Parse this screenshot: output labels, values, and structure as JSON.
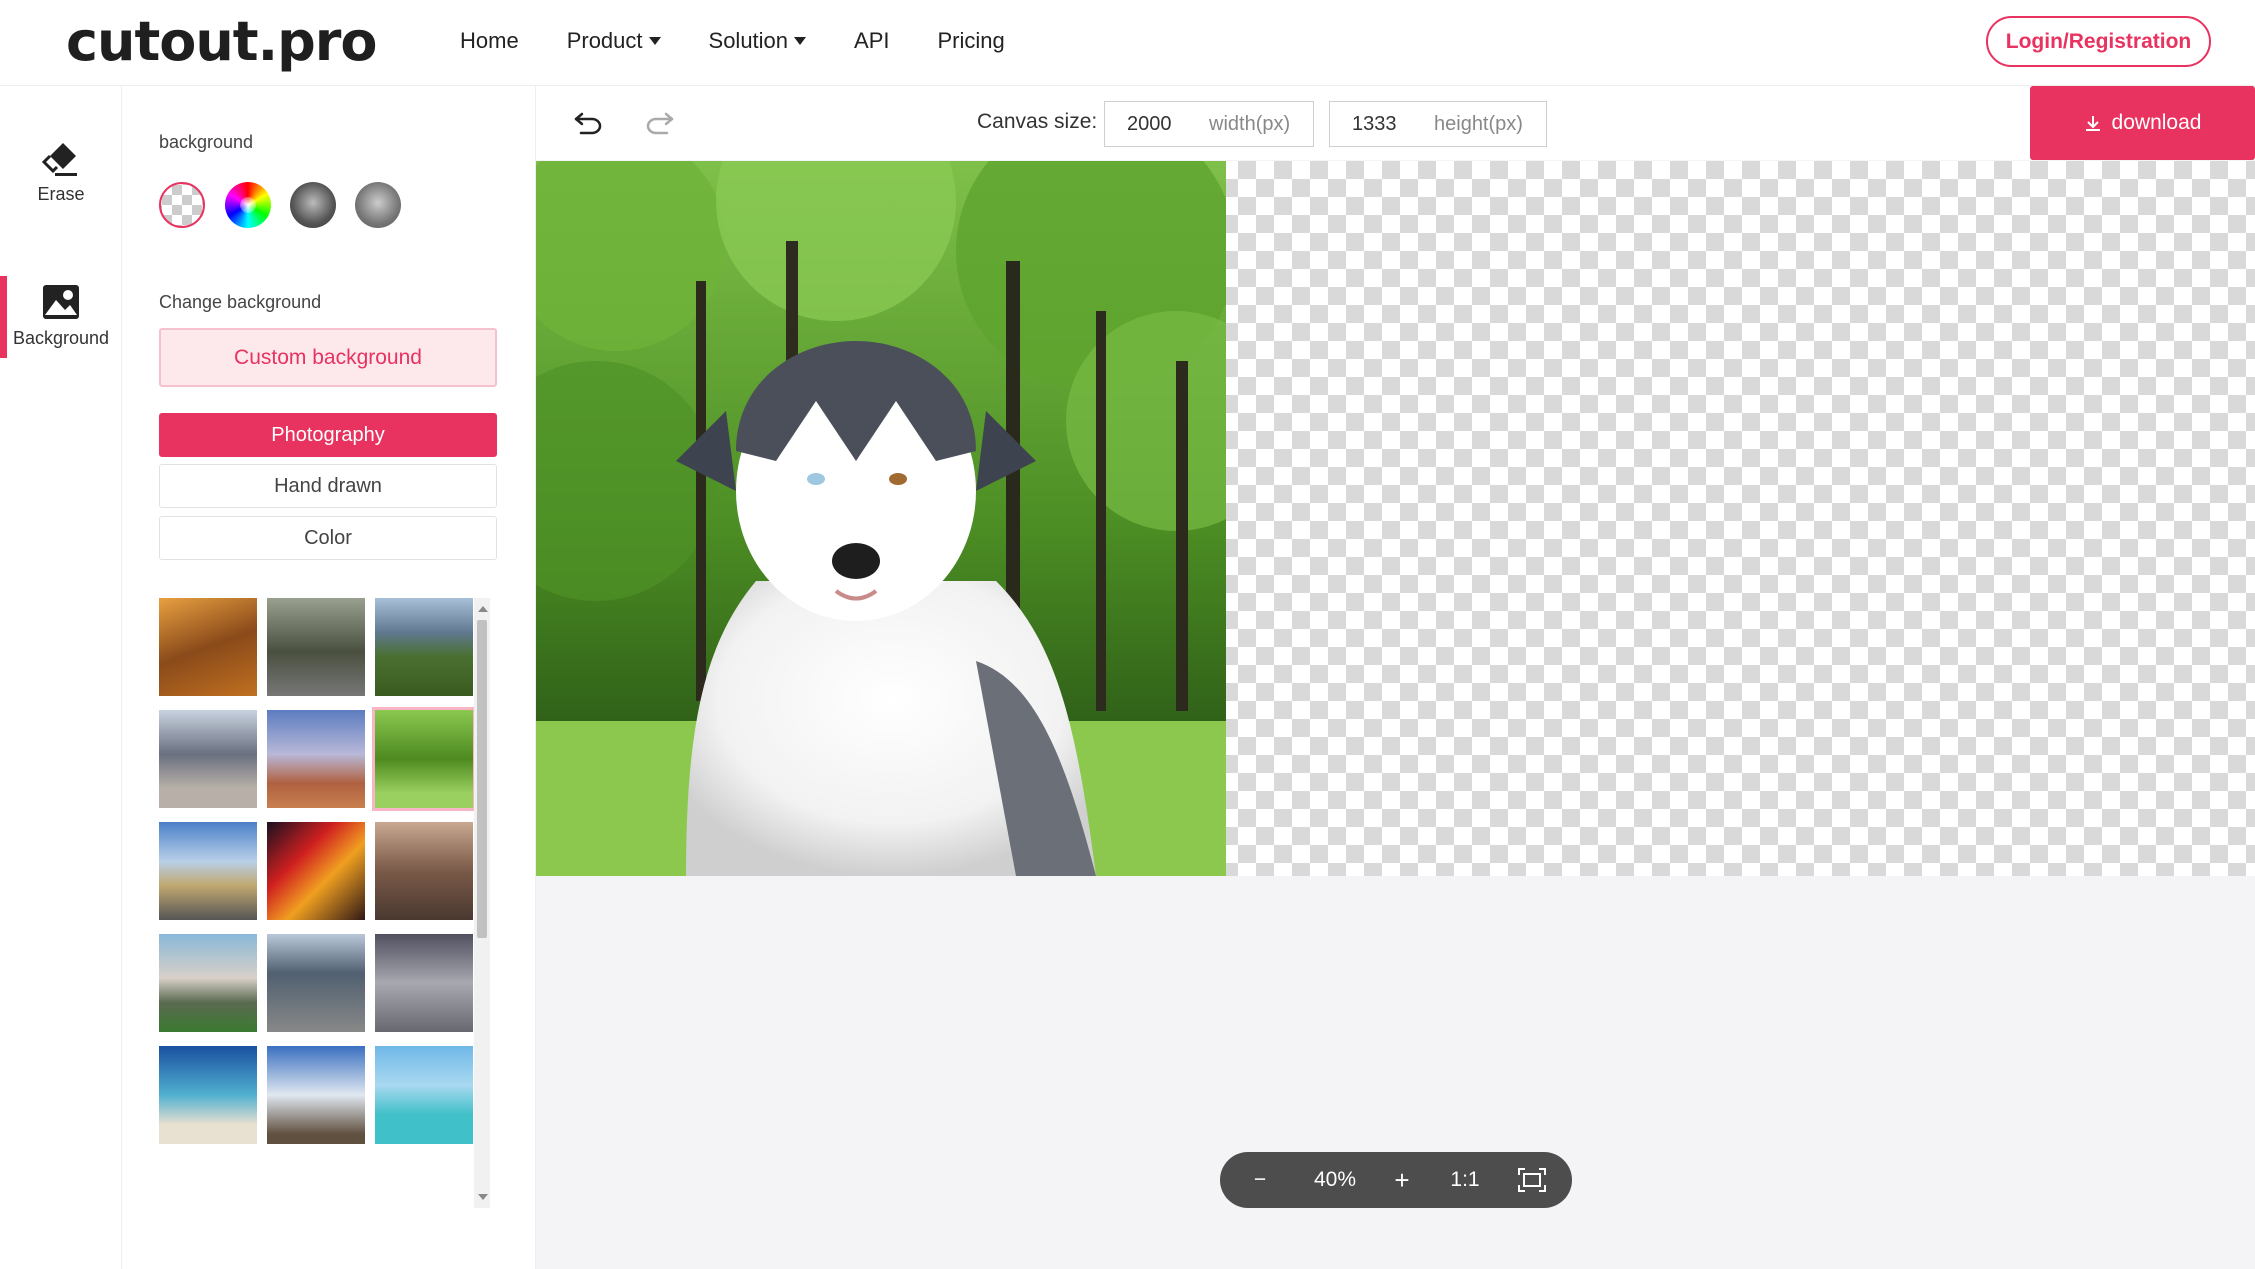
{
  "app": {
    "logo": "cutout.pro",
    "nav": [
      {
        "label": "Home"
      },
      {
        "label": "Product",
        "dropdown": true
      },
      {
        "label": "Solution",
        "dropdown": true
      },
      {
        "label": "API"
      },
      {
        "label": "Pricing"
      }
    ],
    "login_label": "Login/Registration",
    "accent": "#e8325f"
  },
  "rail": {
    "items": [
      {
        "label": "Erase",
        "icon": "eraser-icon"
      },
      {
        "label": "Background",
        "icon": "image-icon",
        "active": true
      }
    ]
  },
  "panel": {
    "background_label": "background",
    "swatches": [
      "transparent-swatch",
      "color-wheel-swatch",
      "image-blur-swatch",
      "image-gray-swatch"
    ],
    "change_bg_label": "Change background",
    "custom_bg_label": "Custom background",
    "categories": [
      {
        "label": "Photography",
        "active": true
      },
      {
        "label": "Hand drawn"
      },
      {
        "label": "Color"
      }
    ],
    "thumbnails": [
      "autumn-forest-path",
      "forest-road",
      "mountain-valley-road",
      "cloudy-plain",
      "desert-sky",
      "green-park-trees",
      "coastal-highway",
      "city-light-trails",
      "old-town-street",
      "alpine-chalet",
      "city-avenue",
      "gothic-corridor",
      "tropical-beach",
      "eiffel-tower",
      "sea-hut"
    ],
    "selected_thumbnail": "green-park-trees"
  },
  "toolbar": {
    "undo_icon": "undo-icon",
    "redo_icon": "redo-icon",
    "canvas_size_label": "Canvas size:",
    "width_value": "2000",
    "width_unit": "width(px)",
    "height_value": "1333",
    "height_unit": "height(px)",
    "download_label": "download"
  },
  "zoom": {
    "minus": "−",
    "level": "40%",
    "plus": "+",
    "ratio": "1:1",
    "fit_icon": "fit-screen-icon"
  }
}
